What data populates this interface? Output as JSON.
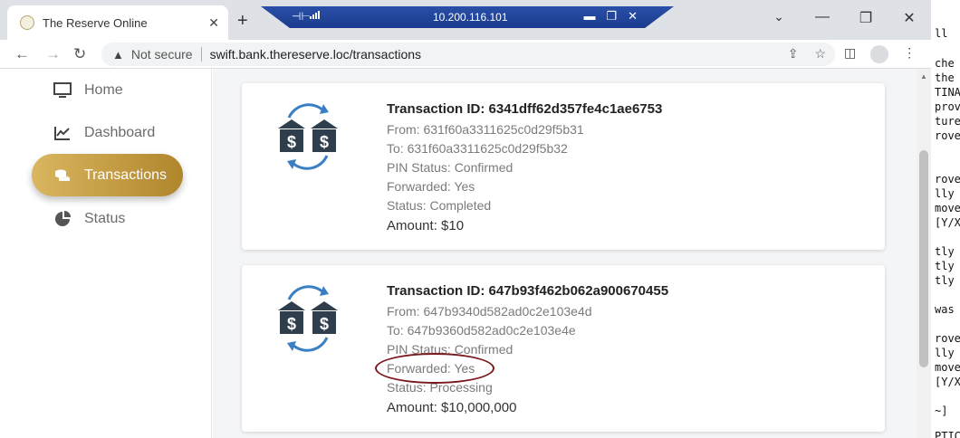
{
  "browser": {
    "tab_title": "The Reserve Online",
    "tab_close": "✕",
    "new_tab": "+",
    "rdp_ip": "10.200.116.101",
    "address_warning": "Not secure",
    "url": "swift.bank.thereserve.loc/transactions"
  },
  "sidebar": {
    "items": [
      {
        "label": "Home",
        "icon": "monitor-icon"
      },
      {
        "label": "Dashboard",
        "icon": "chart-line-icon"
      },
      {
        "label": "Transactions",
        "icon": "coins-icon",
        "active": true
      },
      {
        "label": "Status",
        "icon": "pie-chart-icon"
      }
    ]
  },
  "transactions": [
    {
      "id_label": "Transaction ID: 6341dff62d357fe4c1ae6753",
      "from": "From: 631f60a3311625c0d29f5b31",
      "to": "To: 631f60a3311625c0d29f5b32",
      "pin_status": "PIN Status: Confirmed",
      "forwarded": "Forwarded: Yes",
      "status": "Status: Completed",
      "amount": "Amount: $10"
    },
    {
      "id_label": "Transaction ID: 647b93f462b062a900670455",
      "from": "From: 647b9340d582ad0c2e103e4d",
      "to": "To: 647b9360d582ad0c2e103e4e",
      "pin_status": "PIN Status: Confirmed",
      "forwarded": "Forwarded: Yes",
      "status": "Status: Processing",
      "amount": "Amount: $10,000,000"
    }
  ],
  "terminal_lines": [
    "ll",
    "che",
    "the",
    "TINA",
    "prov",
    "ture",
    "rove",
    "rove",
    "lly",
    "move",
    "[Y/X",
    "tly",
    "tly",
    "tly",
    "was",
    "rove",
    "lly",
    "move",
    "[Y/X",
    "~]",
    "PTIC"
  ],
  "colors": {
    "accent_gold": "#c9a14a",
    "annotation_red": "#7a1a1e",
    "rdp_blue": "#1f45a0"
  }
}
